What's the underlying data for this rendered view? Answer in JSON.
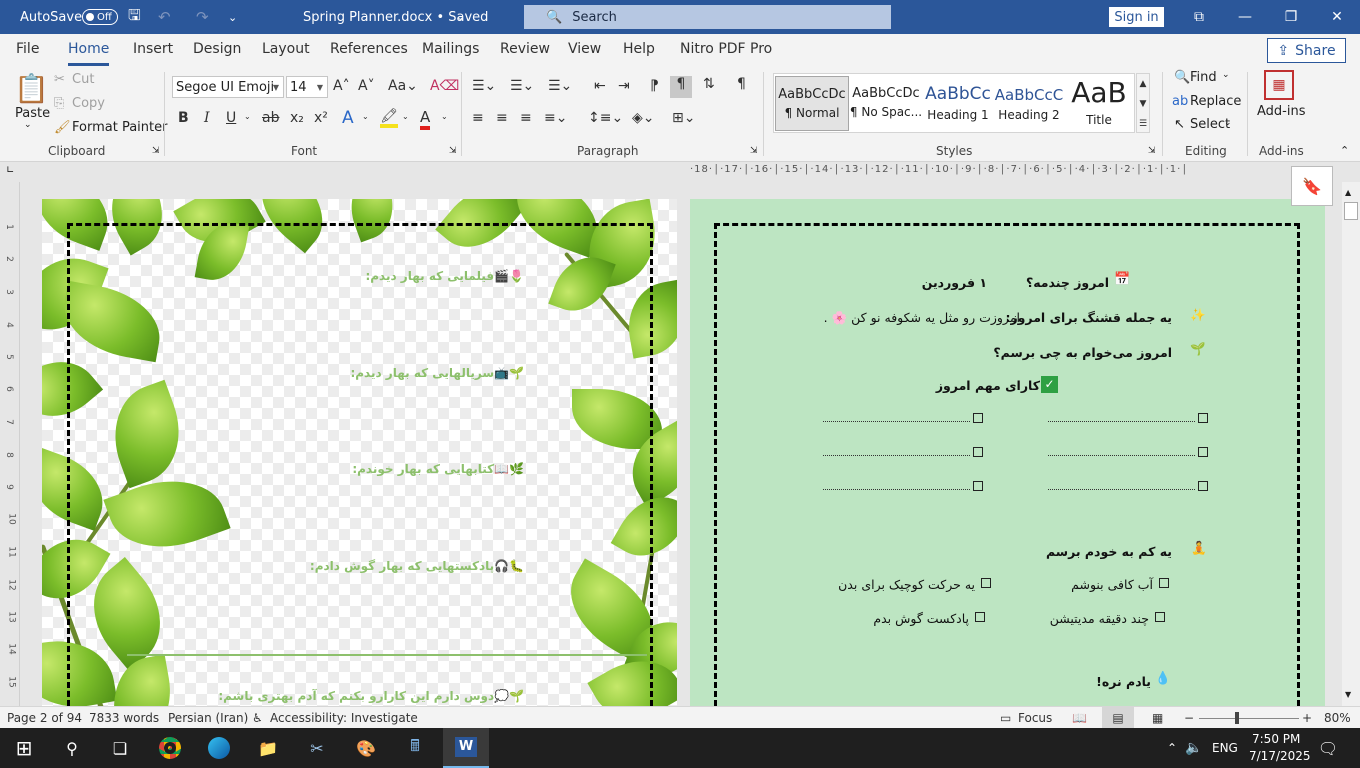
{
  "titlebar": {
    "autosave_label": "AutoSave",
    "autosave_state": "Off",
    "document_title": "Spring Planner.docx • Saved",
    "search_placeholder": "Search",
    "signin_label": "Sign in"
  },
  "tabs": [
    "File",
    "Home",
    "Insert",
    "Design",
    "Layout",
    "References",
    "Mailings",
    "Review",
    "View",
    "Help",
    "Nitro PDF Pro"
  ],
  "active_tab": "Home",
  "share_label": "Share",
  "ribbon": {
    "clipboard": {
      "paste": "Paste",
      "cut": "Cut",
      "copy": "Copy",
      "format_painter": "Format Painter",
      "label": "Clipboard"
    },
    "font": {
      "family": "Segoe UI Emoji",
      "size": "14",
      "label": "Font",
      "bold": "B",
      "italic": "I",
      "underline": "U",
      "strike": "ab",
      "sub": "x₂",
      "sup": "x²"
    },
    "paragraph": {
      "label": "Paragraph"
    },
    "styles": {
      "label": "Styles",
      "items": [
        {
          "preview": "AaBbCcDc",
          "name": "¶ Normal"
        },
        {
          "preview": "AaBbCcDc",
          "name": "¶ No Spac..."
        },
        {
          "preview": "AaBbCc",
          "name": "Heading 1"
        },
        {
          "preview": "AaBbCcC",
          "name": "Heading 2"
        },
        {
          "preview": "AaB",
          "name": "Title"
        }
      ]
    },
    "editing": {
      "find": "Find",
      "replace": "Replace",
      "select": "Select",
      "label": "Editing"
    },
    "addins": {
      "name": "Add-ins",
      "label": "Add-ins"
    }
  },
  "ruler_text": "·18·│·17·│·16·│·15·│·14·│·13·│·12·│·11·│·10·│·9·│·8·│·7·│·6·│·5·│·4·│·3·│·2·│·1·│·1·│",
  "vruler_numbers": [
    "1",
    "2",
    "3",
    "4",
    "5",
    "6",
    "7",
    "8",
    "9",
    "10",
    "11",
    "12",
    "13",
    "14",
    "15"
  ],
  "page1": {
    "lines": [
      "🌷🎬فیلمایی که بهار دیدم:",
      "🌱📺سریالهایی که بهار دیدم:",
      "🌿📖کتابهایی که بهار خوندم:",
      "🐛🎧پادکستهایی که بهار گوش دادم:",
      "🌱💭دوس دارم این کارارو بکنم که آدم بهتری باشم:"
    ]
  },
  "page2": {
    "date_question": "امروز چندمه؟",
    "date_value": "۱ فروردین",
    "nice_sentence_label": "یه جمله قشنگ برای امروز:",
    "nice_sentence_value": "امروزت رو مثل یه شکوفه نو کن 🌸 .",
    "reach_question": "امروز می‌خوام به چی برسم؟",
    "tasks_title": "کارای مهم امروز",
    "selfcare_title": "یه کم به خودم برسم",
    "selfcare_items": [
      "آب کافی بنوشم",
      "یه حرکت کوچیک برای بدن",
      "چند دقیقه مدیتیشن",
      "پادکست گوش بدم"
    ],
    "remember_title": "یادم نره!"
  },
  "status": {
    "page": "Page 2 of 94",
    "words": "7833 words",
    "language": "Persian (Iran)",
    "accessibility": "Accessibility: Investigate",
    "focus": "Focus",
    "zoom": "80%"
  },
  "taskbar": {
    "language": "ENG",
    "time": "7:50 PM",
    "date": "7/17/2025"
  },
  "colors": {
    "word_blue": "#2b579a",
    "page2_bg": "#bde5c2",
    "page1_text": "#8dc06c"
  }
}
